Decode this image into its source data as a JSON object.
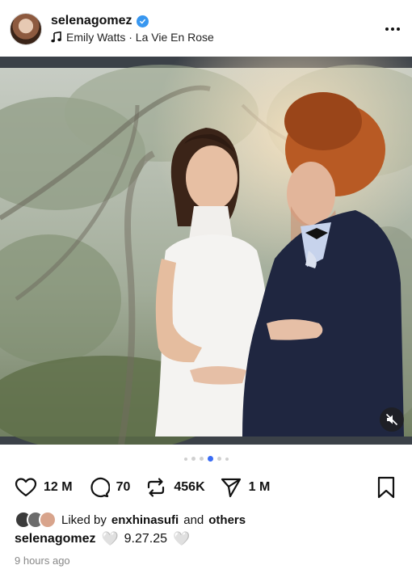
{
  "header": {
    "username": "selenagomez",
    "verified": true,
    "music": {
      "icon": "music-note-icon",
      "text": "Emily Watts · La Vie En Rose"
    },
    "more_icon": "more-options-icon"
  },
  "post": {
    "image_alt": "photo",
    "mute_icon": "muted-speaker-icon",
    "pager": {
      "count": 6,
      "active_index": 3
    }
  },
  "actions": {
    "like_count": "12 M",
    "comment_count": "70",
    "repost_count": "456K",
    "share_count": "1 M"
  },
  "likes": {
    "prefix": "Liked by",
    "user": "enxhinasufi",
    "and": "and",
    "others": "others"
  },
  "caption": {
    "user": "selenagomez",
    "text": "9.27.25",
    "emoji": "🤍"
  },
  "time_ago": "9 hours ago",
  "colors": {
    "verified_blue": "#3897f0",
    "active_dot": "#3a6cf4"
  }
}
